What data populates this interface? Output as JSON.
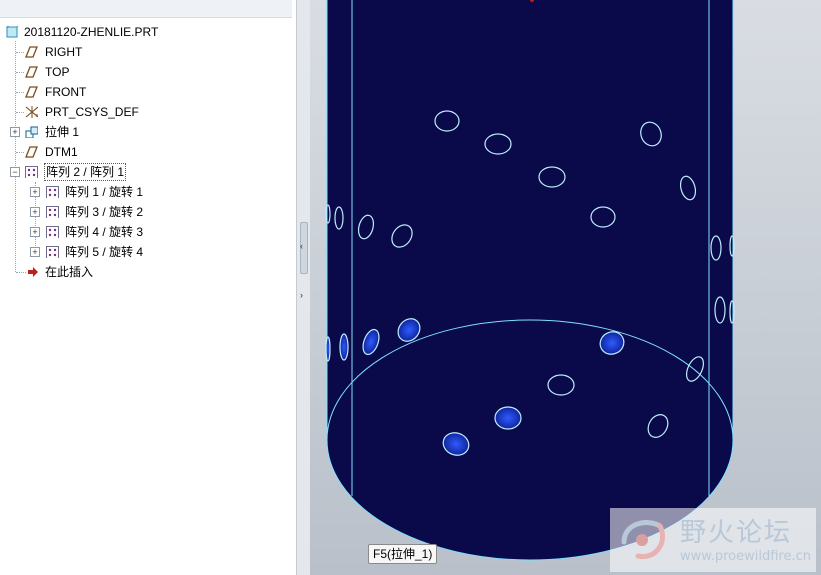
{
  "model_tree": {
    "root": "20181120-ZHENLIE.PRT",
    "items": [
      {
        "label": "RIGHT",
        "icon": "datum-plane-icon"
      },
      {
        "label": "TOP",
        "icon": "datum-plane-icon"
      },
      {
        "label": "FRONT",
        "icon": "datum-plane-icon"
      },
      {
        "label": "PRT_CSYS_DEF",
        "icon": "csys-icon"
      },
      {
        "label": "拉伸 1",
        "icon": "extrude-icon"
      },
      {
        "label": "DTM1",
        "icon": "datum-plane-icon"
      },
      {
        "label": "阵列 2 / 阵列 1",
        "icon": "pattern-icon"
      },
      {
        "label": "阵列 1 / 旋转 1",
        "icon": "pattern-icon"
      },
      {
        "label": "阵列 3 / 旋转 2",
        "icon": "pattern-icon"
      },
      {
        "label": "阵列 4 / 旋转 3",
        "icon": "pattern-icon"
      },
      {
        "label": "阵列 5 / 旋转 4",
        "icon": "pattern-icon"
      },
      {
        "label": "在此插入",
        "icon": "insert-here-arrow-icon"
      }
    ]
  },
  "viewport": {
    "tooltip": "F5(拉伸_1)",
    "model_fill": "#0a0a4a",
    "edge_color": "#7fe0ff"
  },
  "watermark": {
    "title": "野火论坛",
    "url": "www.proewildfire.cn"
  }
}
